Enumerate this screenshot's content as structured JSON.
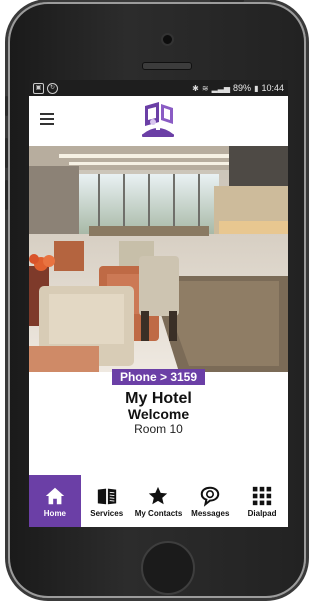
{
  "status_bar": {
    "battery": "89%",
    "time": "10:44"
  },
  "room_info": {
    "extension": "Phone > 3159",
    "hotel_name": "My Hotel",
    "greeting": "Welcome",
    "room": "Room 10"
  },
  "tabs": [
    {
      "label": "Home",
      "icon": "home-icon",
      "active": true
    },
    {
      "label": "Services",
      "icon": "book-icon",
      "active": false
    },
    {
      "label": "My Contacts",
      "icon": "star-icon",
      "active": false
    },
    {
      "label": "Messages",
      "icon": "speech-bubble-icon",
      "active": false
    },
    {
      "label": "Dialpad",
      "icon": "dialpad-grid-icon",
      "active": false
    }
  ],
  "colors": {
    "accent": "#6b3fa6",
    "statusbar": "#1e1e1e"
  }
}
